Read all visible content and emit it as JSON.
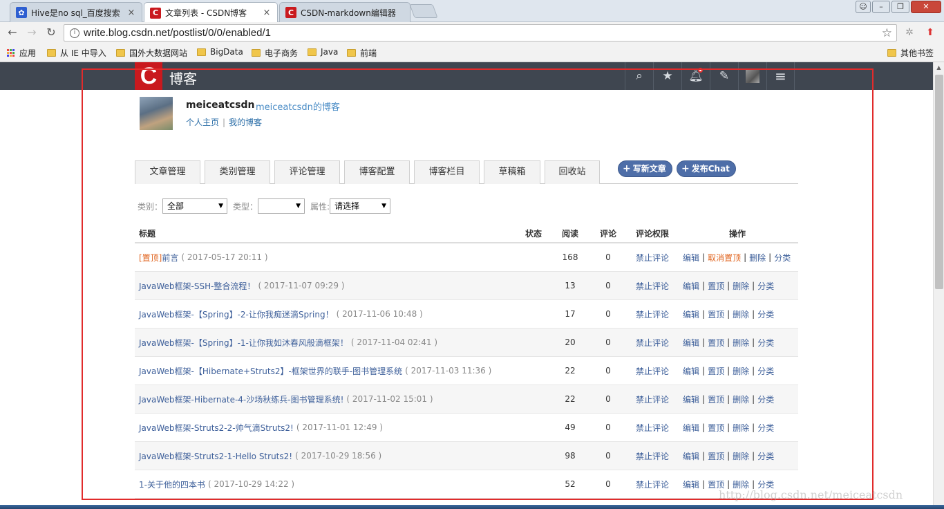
{
  "browser": {
    "tabs": [
      {
        "title": "Hive是no sql_百度搜索",
        "icon": "baidu-paw-icon",
        "active": false
      },
      {
        "title": "文章列表 - CSDN博客",
        "icon": "csdn-c-icon",
        "active": true
      },
      {
        "title": "CSDN-markdown编辑器",
        "icon": "csdn-c-icon",
        "active": false
      }
    ],
    "tab_close": "×",
    "url": "write.blog.csdn.net/postlist/0/0/enabled/1",
    "bookmarks": [
      {
        "label": "应用",
        "type": "apps"
      },
      {
        "label": "从 IE 中导入",
        "type": "folder"
      },
      {
        "label": "国外大数据网站",
        "type": "folder"
      },
      {
        "label": "BigData",
        "type": "folder"
      },
      {
        "label": "电子商务",
        "type": "folder"
      },
      {
        "label": "Java",
        "type": "folder"
      },
      {
        "label": "前端",
        "type": "folder"
      },
      {
        "label": "其他书签",
        "type": "folder"
      }
    ]
  },
  "header": {
    "logo_letter": "C",
    "logo_text": "博客",
    "icons": [
      "search-icon",
      "star-icon",
      "bell-icon",
      "edit-icon",
      "avatar-icon",
      "menu-icon"
    ]
  },
  "profile": {
    "username": "meiceatcsdn",
    "blog_link": "meiceatcsdn的博客",
    "home_link": "个人主页",
    "separator": "|",
    "my_blog_link": "我的博客"
  },
  "tabs": [
    "文章管理",
    "类别管理",
    "评论管理",
    "博客配置",
    "博客栏目",
    "草稿箱",
    "回收站"
  ],
  "actions": {
    "plus": "+",
    "write": "写新文章",
    "chat": "发布Chat"
  },
  "filters": {
    "category_label": "类别：",
    "category_value": "全部",
    "type_label": "类型：",
    "type_value": "",
    "attr_label": "属性:",
    "attr_value": "请选择",
    "caret": "▼"
  },
  "table": {
    "headers": {
      "title": "标题",
      "status": "状态",
      "reads": "阅读",
      "comments": "评论",
      "permission": "评论权限",
      "ops": "操作"
    },
    "rows": [
      {
        "pin": "[置顶]",
        "title": "前言",
        "date": "( 2017-05-17 20:11 )",
        "reads": "168",
        "comments": "0",
        "permission": "禁止评论",
        "ops": [
          "编辑",
          "取消置顶",
          "删除",
          "分类"
        ]
      },
      {
        "pin": "",
        "title": "JavaWeb框架-SSH-整合流程！",
        "date": "( 2017-11-07 09:29 )",
        "reads": "13",
        "comments": "0",
        "permission": "禁止评论",
        "ops": [
          "编辑",
          "置顶",
          "删除",
          "分类"
        ]
      },
      {
        "pin": "",
        "title": "JavaWeb框架-【Spring】-2-让你我痴迷滴Spring！",
        "date": "( 2017-11-06 10:48 )",
        "reads": "17",
        "comments": "0",
        "permission": "禁止评论",
        "ops": [
          "编辑",
          "置顶",
          "删除",
          "分类"
        ]
      },
      {
        "pin": "",
        "title": "JavaWeb框架-【Spring】-1-让你我如沐春风般滴框架！",
        "date": "( 2017-11-04 02:41 )",
        "reads": "20",
        "comments": "0",
        "permission": "禁止评论",
        "ops": [
          "编辑",
          "置顶",
          "删除",
          "分类"
        ]
      },
      {
        "pin": "",
        "title": "JavaWeb框架-【Hibernate+Struts2】-框架世界的联手-图书管理系统",
        "date": "( 2017-11-03 11:36 )",
        "reads": "22",
        "comments": "0",
        "permission": "禁止评论",
        "ops": [
          "编辑",
          "置顶",
          "删除",
          "分类"
        ]
      },
      {
        "pin": "",
        "title": "JavaWeb框架-Hibernate-4-沙场秋练兵-图书管理系统!",
        "date": "( 2017-11-02 15:01 )",
        "reads": "22",
        "comments": "0",
        "permission": "禁止评论",
        "ops": [
          "编辑",
          "置顶",
          "删除",
          "分类"
        ]
      },
      {
        "pin": "",
        "title": "JavaWeb框架-Struts2-2-帅气滴Struts2!",
        "date": "( 2017-11-01 12:49 )",
        "reads": "49",
        "comments": "0",
        "permission": "禁止评论",
        "ops": [
          "编辑",
          "置顶",
          "删除",
          "分类"
        ]
      },
      {
        "pin": "",
        "title": "JavaWeb框架-Struts2-1-Hello Struts2!",
        "date": "( 2017-10-29 18:56 )",
        "reads": "98",
        "comments": "0",
        "permission": "禁止评论",
        "ops": [
          "编辑",
          "置顶",
          "删除",
          "分类"
        ]
      },
      {
        "pin": "",
        "title": "1-关于他的四本书",
        "date": "( 2017-10-29 14:22 )",
        "reads": "52",
        "comments": "0",
        "permission": "禁止评论",
        "ops": [
          "编辑",
          "置顶",
          "删除",
          "分类"
        ]
      }
    ],
    "op_separator": "|"
  },
  "watermark": "http://blog.csdn.net/meiceatcsdn",
  "colors": {
    "csdn_red": "#c9191e",
    "header_bg": "#3f4650",
    "link_blue": "#3d5f9a",
    "accent_orange": "#e0641f",
    "frame_red": "#e12b2b"
  }
}
